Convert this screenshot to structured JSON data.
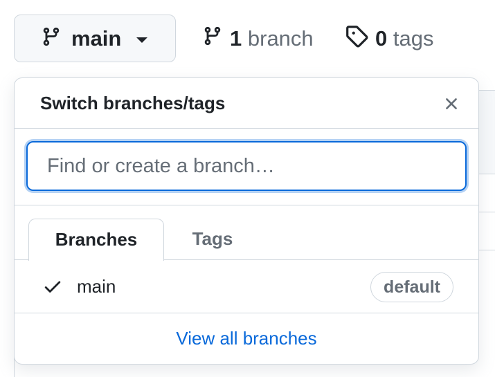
{
  "toolbar": {
    "branch_button_label": "main",
    "branches_count": "1",
    "branches_label": "branch",
    "tags_count": "0",
    "tags_label": "tags"
  },
  "dropdown": {
    "title": "Switch branches/tags",
    "filter": {
      "placeholder": "Find or create a branch…",
      "value": ""
    },
    "tabs": [
      {
        "label": "Branches",
        "active": true
      },
      {
        "label": "Tags",
        "active": false
      }
    ],
    "branches": [
      {
        "name": "main",
        "checked": true,
        "badge": "default"
      }
    ],
    "footer_link": "View all branches"
  },
  "colors": {
    "accent": "#0969da",
    "border": "#d0d7de",
    "text": "#1f2328",
    "muted": "#656d76",
    "button_bg": "#f6f8fa"
  },
  "icons": {
    "branch": "git-branch-icon",
    "tag": "tag-icon",
    "close": "close-icon",
    "check": "check-icon",
    "caret": "caret-down-icon"
  }
}
